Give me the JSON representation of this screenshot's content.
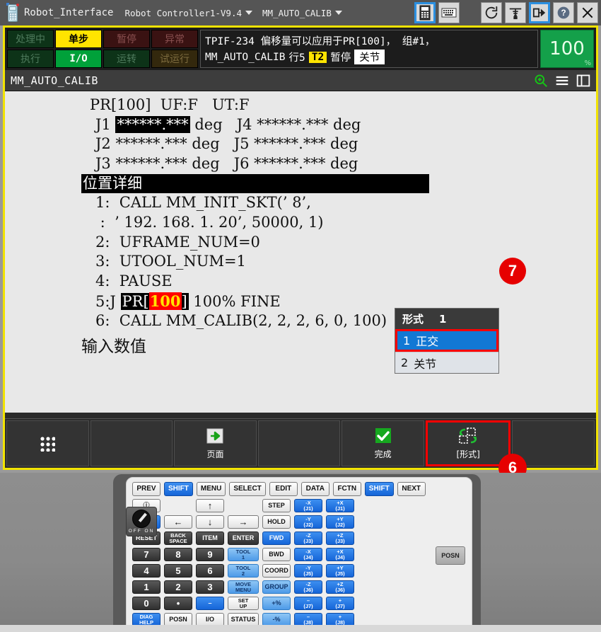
{
  "titlebar": {
    "app_name": "Robot_Interface",
    "controller": "Robot Controller1-V9.4",
    "program": "MM_AUTO_CALIB",
    "icons": [
      {
        "name": "teach-pendant-icon",
        "selected": true
      },
      {
        "name": "keyboard-icon",
        "selected": false
      },
      {
        "name": "refresh-icon",
        "selected": false
      },
      {
        "name": "robot-icon",
        "selected": false
      },
      {
        "name": "export-icon",
        "selected": true
      },
      {
        "name": "help-icon",
        "selected": false
      },
      {
        "name": "close-icon",
        "selected": false
      }
    ]
  },
  "status": {
    "cells": [
      {
        "label": "处理中",
        "state": "dim-green"
      },
      {
        "label": "单步",
        "state": "on-yellow"
      },
      {
        "label": "暂停",
        "state": "dim-red"
      },
      {
        "label": "异常",
        "state": "dim-red"
      },
      {
        "label": "执行",
        "state": "dim-green"
      },
      {
        "label": "I/O",
        "state": "on-green"
      },
      {
        "label": "运转",
        "state": "dim-green"
      },
      {
        "label": "试运行",
        "state": "dim-olive"
      }
    ],
    "message_line1": "TPIF-234 偏移量可以应用于PR[100]， 组#1，",
    "message_line2_prog": "MM_AUTO_CALIB",
    "message_line2_line": "行5",
    "message_line2_mode": "T2",
    "message_line2_state": "暂停",
    "message_line2_coord": "关节",
    "speed": "100",
    "speed_unit": "%"
  },
  "program_header": {
    "title": "MM_AUTO_CALIB",
    "icons": [
      "zoom-in-icon",
      "menu-icon",
      "layout-icon"
    ]
  },
  "position_register": {
    "header": "PR[100]  UF:F   UT:F",
    "joints": [
      {
        "name": "J1",
        "value": "******.***",
        "unit": "deg",
        "highlighted": true
      },
      {
        "name": "J4",
        "value": "******.***",
        "unit": "deg",
        "highlighted": false
      },
      {
        "name": "J2",
        "value": "******.***",
        "unit": "deg",
        "highlighted": false
      },
      {
        "name": "J5",
        "value": "******.***",
        "unit": "deg",
        "highlighted": false
      },
      {
        "name": "J3",
        "value": "******.***",
        "unit": "deg",
        "highlighted": false
      },
      {
        "name": "J6",
        "value": "******.***",
        "unit": "deg",
        "highlighted": false
      }
    ],
    "section_label": "位置详细"
  },
  "program_lines": [
    {
      "num": "1:",
      "text": "  CALL MM_INIT_SKT(’ 8’,"
    },
    {
      "num": " :",
      "text": "  ’ 192. 168. 1. 20’, 50000, 1)"
    },
    {
      "num": "2:",
      "text": "  UFRAME_NUM=0"
    },
    {
      "num": "3:",
      "text": "  UTOOL_NUM=1"
    },
    {
      "num": "4:",
      "text": "  PAUSE"
    },
    {
      "num": "5:J",
      "text": " PR[100]  100% FINE",
      "special": "motion"
    },
    {
      "num": "6:",
      "text": "  CALL MM_CALIB(2, 2, 2, 6, 0, 100)"
    }
  ],
  "motion_line": {
    "prefix": "5:J",
    "pr_open": "PR[",
    "pr_index": "100",
    "pr_close": "]",
    "suffix": "100% FINE"
  },
  "prompt": "输入数值",
  "dropdown": {
    "header_label": "形式",
    "header_value": "1",
    "items": [
      {
        "num": "1",
        "label": "正交",
        "selected": true
      },
      {
        "num": "2",
        "label": "关节",
        "selected": false
      }
    ]
  },
  "badges": {
    "dropdown_badge": "7",
    "softkey_badge": "6"
  },
  "softkeys": [
    {
      "label": "",
      "icon": "grid-icon",
      "marked": false
    },
    {
      "label": "",
      "icon": "",
      "marked": false
    },
    {
      "label": "页面",
      "icon": "page-next-icon",
      "marked": false
    },
    {
      "label": "",
      "icon": "",
      "marked": false
    },
    {
      "label": "完成",
      "icon": "check-icon",
      "marked": false
    },
    {
      "label": "[形式]",
      "icon": "form-switch-icon",
      "marked": true
    },
    {
      "label": "",
      "icon": "",
      "marked": false
    }
  ],
  "pendant": {
    "top_row": [
      "PREV",
      "SHIFT",
      "MENU",
      "SELECT",
      "EDIT",
      "DATA",
      "FCTN",
      "SHIFT",
      "NEXT"
    ],
    "knob": {
      "off": "OFF",
      "on": "ON"
    },
    "posn_key": "POSN",
    "columns": [
      {
        "name": "col-display",
        "keys": [
          {
            "label": "ⓘ",
            "style": "white"
          },
          {
            "label": "DISP",
            "style": "blue"
          },
          {
            "label": "RESET",
            "style": "dark"
          },
          {
            "label": "7",
            "style": "dark num"
          },
          {
            "label": "4",
            "style": "dark num"
          },
          {
            "label": "1",
            "style": "dark num"
          },
          {
            "label": "0",
            "style": "dark num"
          },
          {
            "label": "DIAG\nHELP",
            "style": "blue two"
          }
        ]
      },
      {
        "name": "col-arrows-left",
        "keys": [
          {
            "label": "",
            "style": "spacer"
          },
          {
            "label": "←",
            "style": "white arrow"
          },
          {
            "label": "BACK\nSPACE",
            "style": "dark two"
          },
          {
            "label": "8",
            "style": "dark num"
          },
          {
            "label": "5",
            "style": "dark num"
          },
          {
            "label": "2",
            "style": "dark num"
          },
          {
            "label": "•",
            "style": "dark num"
          },
          {
            "label": "POSN",
            "style": "white"
          }
        ]
      },
      {
        "name": "col-arrows-mid",
        "keys": [
          {
            "label": "↑",
            "style": "white arrow"
          },
          {
            "label": "↓",
            "style": "white arrow"
          },
          {
            "label": "ITEM",
            "style": "dark"
          },
          {
            "label": "9",
            "style": "dark num"
          },
          {
            "label": "6",
            "style": "dark num"
          },
          {
            "label": "3",
            "style": "dark num"
          },
          {
            "label": "–",
            "style": "blue"
          },
          {
            "label": "I/O",
            "style": "white"
          }
        ]
      },
      {
        "name": "col-enter",
        "keys": [
          {
            "label": "",
            "style": "spacer"
          },
          {
            "label": "→",
            "style": "white arrow"
          },
          {
            "label": "ENTER",
            "style": "dark"
          },
          {
            "label": "TOOL\n1",
            "style": "lblue two"
          },
          {
            "label": "TOOL\n2",
            "style": "lblue two"
          },
          {
            "label": "MOVE\nMENU",
            "style": "lblue two"
          },
          {
            "label": "SET\nUP",
            "style": "white two"
          },
          {
            "label": "STATUS",
            "style": "white"
          }
        ]
      },
      {
        "name": "col-run",
        "keys": [
          {
            "label": "STEP",
            "style": "white"
          },
          {
            "label": "HOLD",
            "style": "white"
          },
          {
            "label": "FWD",
            "style": "blue"
          },
          {
            "label": "BWD",
            "style": "white"
          },
          {
            "label": "COORD",
            "style": "white"
          },
          {
            "label": "GROUP",
            "style": "lblue"
          },
          {
            "label": "+%",
            "style": "lblue"
          },
          {
            "label": "-%",
            "style": "lblue"
          }
        ]
      },
      {
        "name": "col-jog-minus",
        "keys": [
          {
            "label": "-X\n(J1)",
            "style": "blue two"
          },
          {
            "label": "-Y\n(J2)",
            "style": "blue two"
          },
          {
            "label": "-Z\n(J3)",
            "style": "blue two"
          },
          {
            "label": "-X\n(J4)",
            "style": "blue two"
          },
          {
            "label": "-Y\n(J5)",
            "style": "blue two"
          },
          {
            "label": "-Z\n(J6)",
            "style": "blue two"
          },
          {
            "label": "–\n(J7)",
            "style": "blue two"
          },
          {
            "label": "–\n(J8)",
            "style": "blue two"
          }
        ]
      },
      {
        "name": "col-jog-plus",
        "keys": [
          {
            "label": "+X\n(J1)",
            "style": "blue two"
          },
          {
            "label": "+Y\n(J2)",
            "style": "blue two"
          },
          {
            "label": "+Z\n(J3)",
            "style": "blue two"
          },
          {
            "label": "+X\n(J4)",
            "style": "blue two"
          },
          {
            "label": "+Y\n(J5)",
            "style": "blue two"
          },
          {
            "label": "+Z\n(J6)",
            "style": "blue two"
          },
          {
            "label": "+\n(J7)",
            "style": "blue two"
          },
          {
            "label": "+\n(J8)",
            "style": "blue two"
          }
        ]
      }
    ]
  },
  "colors": {
    "screen_border": "#f2e300",
    "accent_blue": "#1278d4",
    "marker_red": "#e60000",
    "speed_green": "#14a04a",
    "status_yellow": "#ffe400"
  }
}
